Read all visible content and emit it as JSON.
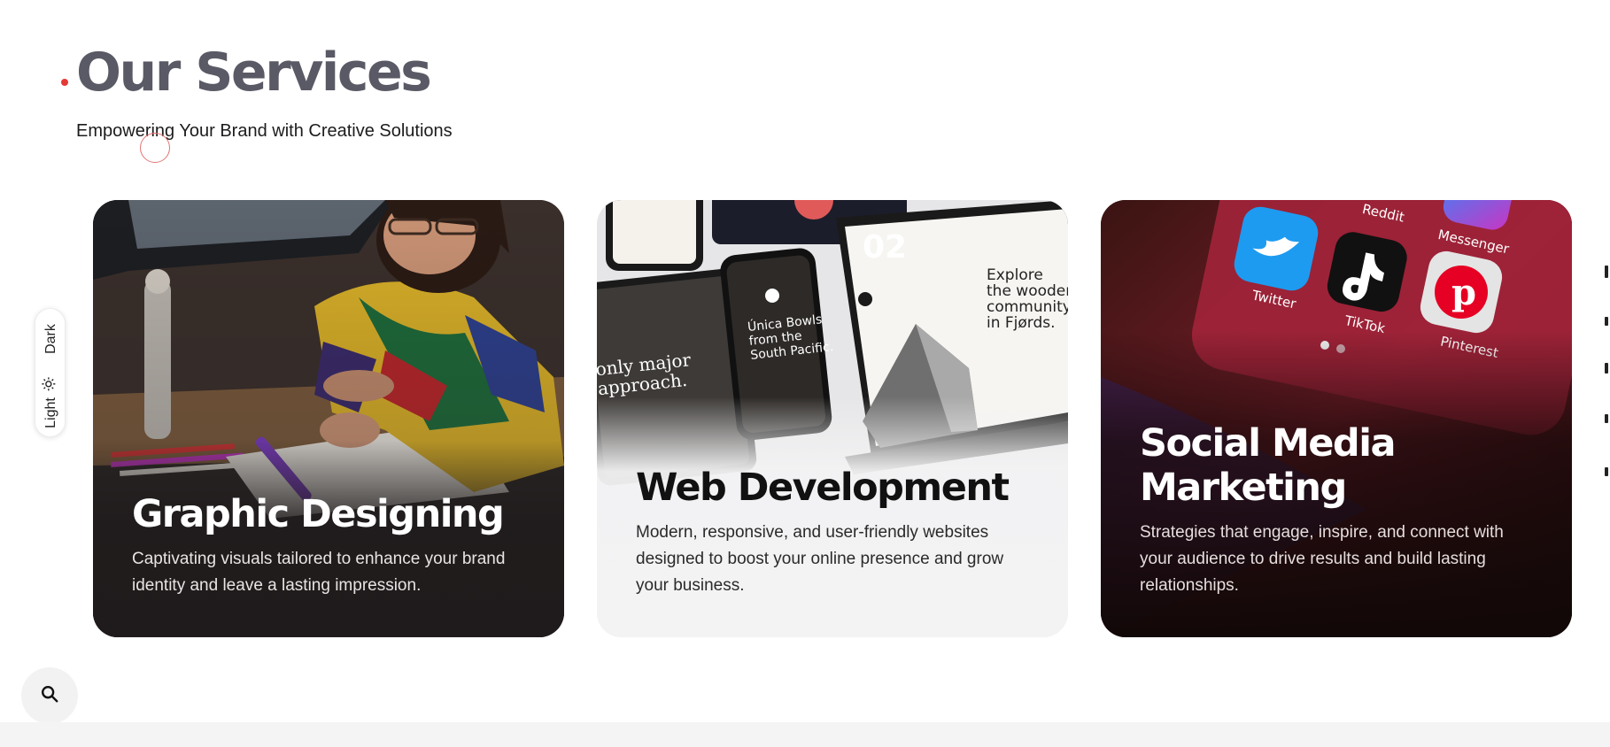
{
  "section": {
    "title": "Our Services",
    "subtitle": "Empowering Your Brand with Creative Solutions",
    "accent_color": "#e53935"
  },
  "theme_toggle": {
    "dark_label": "Dark",
    "light_label": "Light",
    "light_icon": "sun-icon"
  },
  "cards": [
    {
      "title": "Graphic Designing",
      "description": "Captivating visuals tailored to enhance your brand identity and leave a lasting impression."
    },
    {
      "title": "Web Development",
      "description": "Modern, responsive, and user-friendly websites designed to boost your online presence and grow your business.",
      "mockup_text": {
        "headline_right": "Explore the wooden community in Fjørds.",
        "headline_phone": "Única Bowls from the South Pacific.",
        "headline_tablet": "only major approach.",
        "big_number": "02"
      }
    },
    {
      "title": "Social Media Marketing",
      "description": "Strategies that engage, inspire, and connect with your audience to drive results and build lasting relationships.",
      "app_labels": [
        "Reddit",
        "Messenger",
        "Twitter",
        "TikTok",
        "Pinterest"
      ]
    }
  ],
  "search": {
    "icon": "search-icon"
  }
}
